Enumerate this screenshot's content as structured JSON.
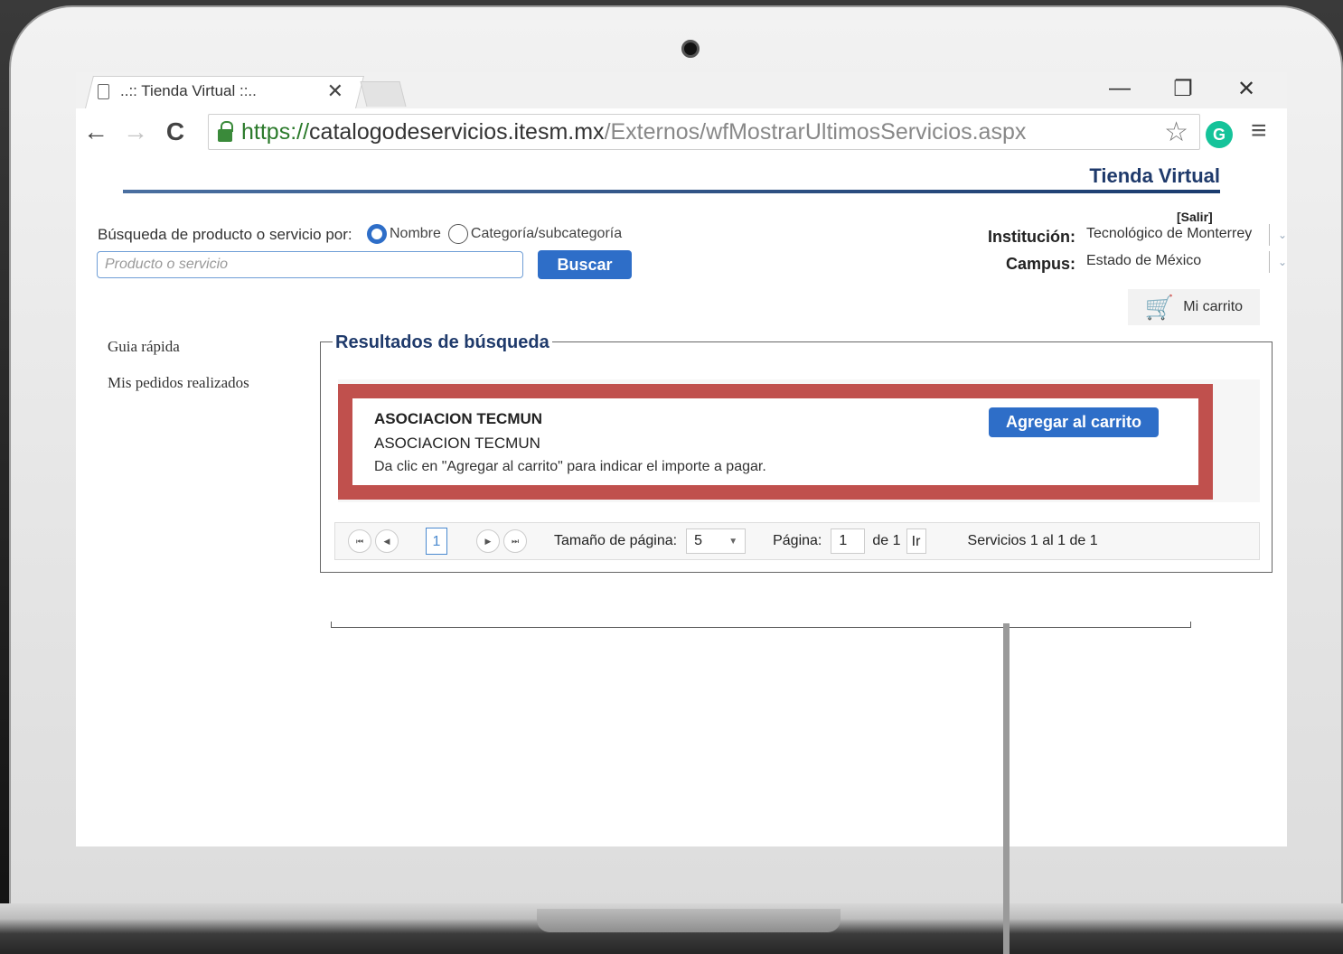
{
  "browser": {
    "tab_title": "..:: Tienda Virtual ::..",
    "url_protocol": "https://",
    "url_host": "catalogodeservicios.itesm.mx",
    "url_path": "/Externos/wfMostrarUltimosServicios.aspx",
    "icons": [
      "document-icon",
      "close-icon",
      "minimize-icon",
      "restore-icon",
      "back-icon",
      "forward-icon",
      "reload-icon",
      "lock-icon",
      "star-icon",
      "grammarly-icon",
      "menu-icon"
    ]
  },
  "header": {
    "site_title": "Tienda Virtual",
    "accent_color": "#1f3a6b"
  },
  "search": {
    "label": "Búsqueda de producto o servicio por:",
    "option_name": "Nombre",
    "option_category": "Categoría/subcategoría",
    "selected": "Nombre",
    "placeholder": "Producto o servicio",
    "value": "",
    "button": "Buscar"
  },
  "account": {
    "logout": "[Salir]",
    "institution_label": "Institución:",
    "institution_value": "Tecnológico de Monterrey",
    "campus_label": "Campus:",
    "campus_value": "Estado de México",
    "cart_button": "Mi carrito"
  },
  "sidebar": {
    "items": [
      {
        "label": "Guia rápida"
      },
      {
        "label": "Mis pedidos realizados"
      }
    ]
  },
  "results": {
    "legend": "Resultados de búsqueda",
    "items": [
      {
        "title": "ASOCIACION TECMUN",
        "subtitle": "ASOCIACION TECMUN",
        "description": "Da clic en \"Agregar al carrito\" para indicar el importe a pagar.",
        "button": "Agregar al carrito"
      }
    ],
    "highlight_color": "#c0504d"
  },
  "pager": {
    "current_page": "1",
    "page_size_label": "Tamaño de página:",
    "page_size": "5",
    "page_label": "Página:",
    "page_value": "1",
    "of_label": "de 1",
    "go_label": "Ir",
    "summary": "Servicios 1 al 1 de 1"
  }
}
